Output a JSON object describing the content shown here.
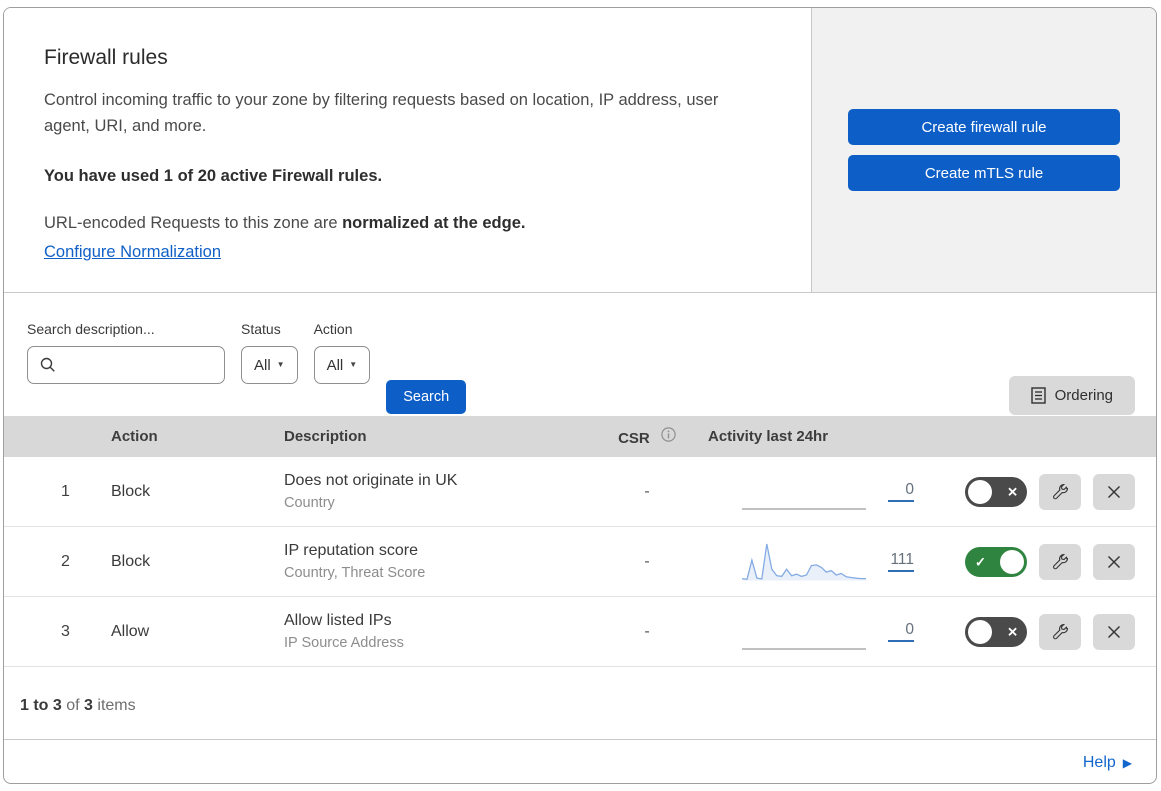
{
  "header": {
    "title": "Firewall rules",
    "description": "Control incoming traffic to your zone by filtering requests based on location, IP address, user agent, URI, and more.",
    "usage_line": "You have used 1 of 20 active Firewall rules.",
    "normalization_prefix": "URL-encoded Requests to this zone are ",
    "normalization_bold": "normalized at the edge.",
    "normalization_link": "Configure Normalization",
    "buttons": {
      "create_firewall_rule": "Create firewall rule",
      "create_mtls_rule": "Create mTLS rule"
    }
  },
  "filters": {
    "search_label": "Search description...",
    "status_label": "Status",
    "status_value": "All",
    "action_label": "Action",
    "action_value": "All",
    "search_button": "Search",
    "ordering_button": "Ordering"
  },
  "table": {
    "columns": {
      "action": "Action",
      "description": "Description",
      "csr": "CSR",
      "activity": "Activity last 24hr"
    },
    "rows": [
      {
        "index": "1",
        "action": "Block",
        "description": "Does not originate in UK",
        "criteria": "Country",
        "csr": "-",
        "count": "0",
        "enabled": false
      },
      {
        "index": "2",
        "action": "Block",
        "description": "IP reputation score",
        "criteria": "Country, Threat Score",
        "csr": "-",
        "count": "111",
        "enabled": true,
        "sparkline": [
          4,
          2,
          55,
          5,
          3,
          100,
          30,
          12,
          10,
          30,
          12,
          16,
          10,
          14,
          40,
          42,
          35,
          22,
          26,
          14,
          18,
          9,
          7,
          5,
          4,
          4
        ]
      },
      {
        "index": "3",
        "action": "Allow",
        "description": "Allow listed IPs",
        "criteria": "IP Source Address",
        "csr": "-",
        "count": "0",
        "enabled": false
      }
    ]
  },
  "footer": {
    "range_bold": "1 to 3",
    "of_text": " of ",
    "total_bold": "3",
    "items_text": " items",
    "help_label": "Help"
  },
  "icons": {
    "caret_down": "▼",
    "toggle_check": "✓",
    "toggle_cross": "✕",
    "help_arrow": "▶"
  },
  "colors": {
    "accent_blue": "#0d5fc7",
    "link_blue": "#1160c7",
    "toggle_on_green": "#2f8540",
    "toggle_off_gray": "#4a4a4a",
    "sparkline_blue": "#85abe4",
    "table_header_gray": "#d8d8d8",
    "panel_gray": "#f1f1f1"
  }
}
